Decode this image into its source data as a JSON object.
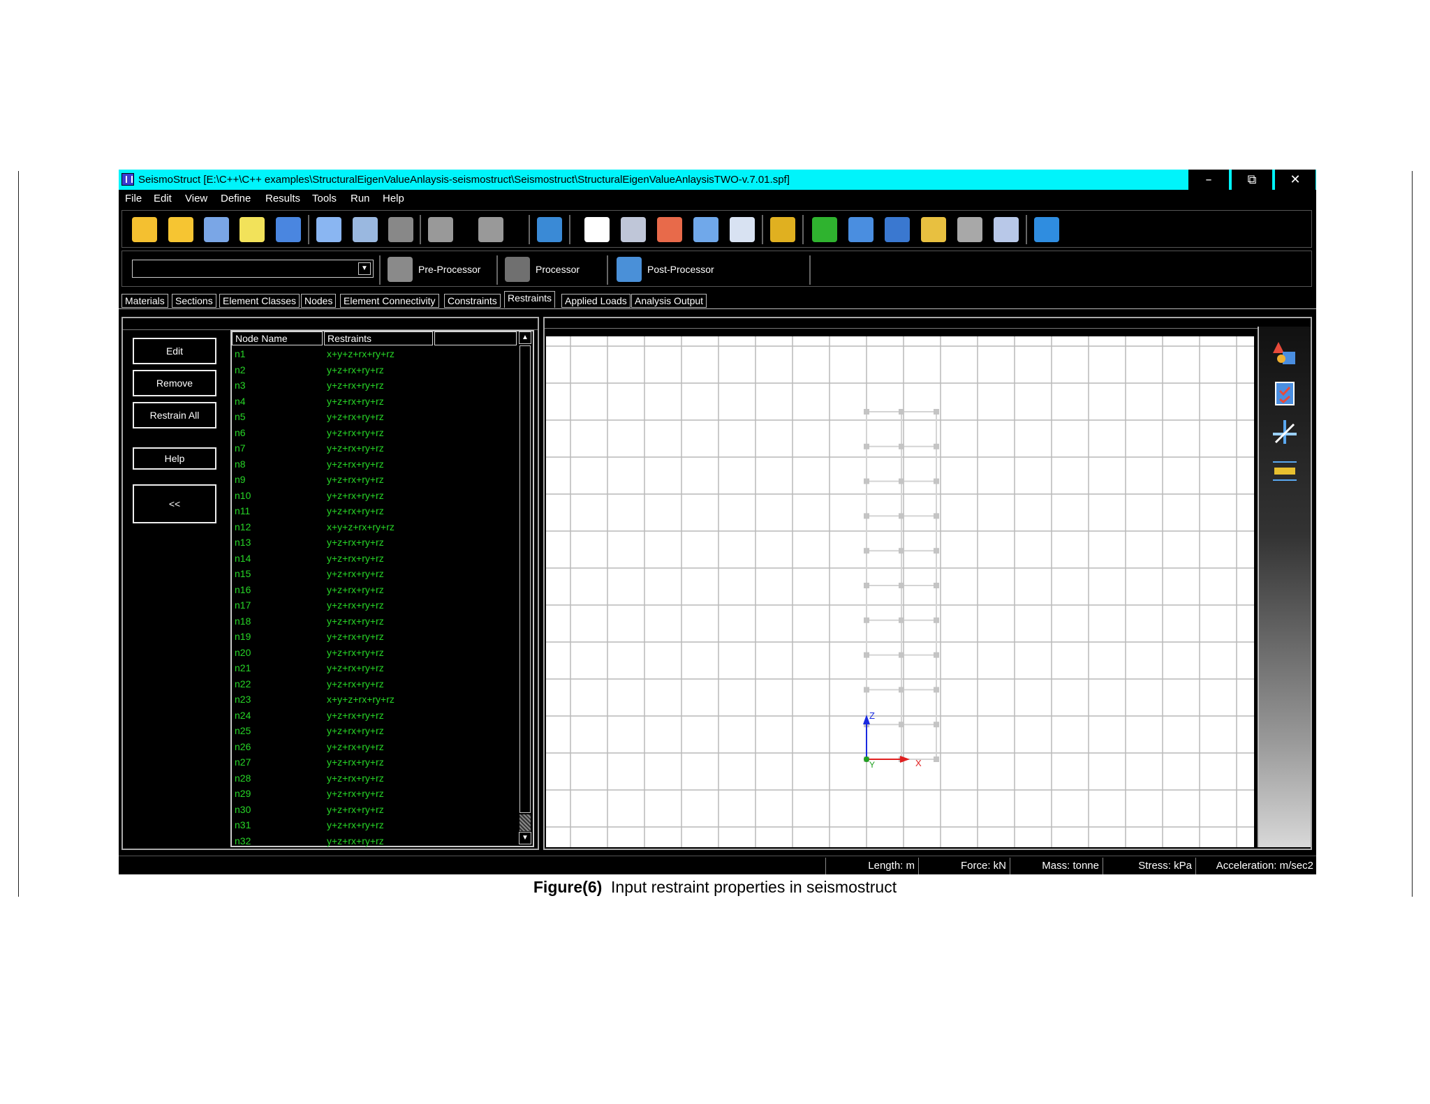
{
  "window": {
    "title": "SeismoStruct   [E:\\C++\\C++ examples\\StructuralEigenValueAnlaysis-seismostruct\\Seismostruct\\StructuralEigenValueAnlaysisTWO-v.7.01.spf]",
    "minimize": "–",
    "restore": "⧉",
    "close": "✕"
  },
  "menu": [
    "File",
    "Edit",
    "View",
    "Define",
    "Results",
    "Tools",
    "Run",
    "Help"
  ],
  "toolbar_icons": [
    {
      "icon": "new-file-icon",
      "color": "#f4c030"
    },
    {
      "icon": "open-folder-icon",
      "color": "#f6c532"
    },
    {
      "icon": "building-icon",
      "color": "#7aa6e6"
    },
    {
      "icon": "wizard-icon",
      "color": "#f2e25a"
    },
    {
      "icon": "save-icon",
      "color": "#4a86e0"
    },
    {
      "icon": "copy-icon",
      "color": "#8ab6f2"
    },
    {
      "icon": "paste-icon",
      "color": "#9ab8e0"
    },
    {
      "icon": "clipboard-icon",
      "color": "#888888"
    },
    {
      "icon": "undo-icon",
      "color": "#999999"
    },
    {
      "icon": "redo-icon",
      "color": "#999999"
    },
    {
      "icon": "network-icon",
      "color": "#3a8ad6"
    },
    {
      "icon": "units-icon",
      "color": "#ffffff"
    },
    {
      "icon": "settings-gear-icon",
      "color": "#bfc6d8"
    },
    {
      "icon": "sparkle-gear-icon",
      "color": "#e86a4a"
    },
    {
      "icon": "calculator-icon",
      "color": "#70a8ea"
    },
    {
      "icon": "table-grid-icon",
      "color": "#d8e2f2"
    },
    {
      "icon": "brush-icon",
      "color": "#e0b020"
    },
    {
      "icon": "help-circle-icon",
      "color": "#2fb32f"
    },
    {
      "icon": "book-icon",
      "color": "#4a8ee0"
    },
    {
      "icon": "manual-check-icon",
      "color": "#3a78d0"
    },
    {
      "icon": "search-document-icon",
      "color": "#e8c040"
    },
    {
      "icon": "film-reel-icon",
      "color": "#a8a8a8"
    },
    {
      "icon": "chat-bubbles-icon",
      "color": "#b8c8e8"
    },
    {
      "icon": "globe-icon",
      "color": "#2f8de0"
    }
  ],
  "modes": {
    "pre": "Pre-Processor",
    "processor": "Processor",
    "post": "Post-Processor"
  },
  "tabs": [
    "Materials",
    "Sections",
    "Element Classes",
    "Nodes",
    "Element Connectivity",
    "Constraints",
    "Restraints",
    "Applied Loads",
    "Analysis Output"
  ],
  "active_tab": "Restraints",
  "buttons": {
    "edit": "Edit",
    "remove": "Remove",
    "restrain_all": "Restrain All",
    "help": "Help",
    "collapse": "<<"
  },
  "table": {
    "columns": [
      "Node Name",
      "Restraints",
      ""
    ],
    "rows": [
      [
        "n1",
        "x+y+z+rx+ry+rz"
      ],
      [
        "n2",
        "y+z+rx+ry+rz"
      ],
      [
        "n3",
        "y+z+rx+ry+rz"
      ],
      [
        "n4",
        "y+z+rx+ry+rz"
      ],
      [
        "n5",
        "y+z+rx+ry+rz"
      ],
      [
        "n6",
        "y+z+rx+ry+rz"
      ],
      [
        "n7",
        "y+z+rx+ry+rz"
      ],
      [
        "n8",
        "y+z+rx+ry+rz"
      ],
      [
        "n9",
        "y+z+rx+ry+rz"
      ],
      [
        "n10",
        "y+z+rx+ry+rz"
      ],
      [
        "n11",
        "y+z+rx+ry+rz"
      ],
      [
        "n12",
        "x+y+z+rx+ry+rz"
      ],
      [
        "n13",
        "y+z+rx+ry+rz"
      ],
      [
        "n14",
        "y+z+rx+ry+rz"
      ],
      [
        "n15",
        "y+z+rx+ry+rz"
      ],
      [
        "n16",
        "y+z+rx+ry+rz"
      ],
      [
        "n17",
        "y+z+rx+ry+rz"
      ],
      [
        "n18",
        "y+z+rx+ry+rz"
      ],
      [
        "n19",
        "y+z+rx+ry+rz"
      ],
      [
        "n20",
        "y+z+rx+ry+rz"
      ],
      [
        "n21",
        "y+z+rx+ry+rz"
      ],
      [
        "n22",
        "y+z+rx+ry+rz"
      ],
      [
        "n23",
        "x+y+z+rx+ry+rz"
      ],
      [
        "n24",
        "y+z+rx+ry+rz"
      ],
      [
        "n25",
        "y+z+rx+ry+rz"
      ],
      [
        "n26",
        "y+z+rx+ry+rz"
      ],
      [
        "n27",
        "y+z+rx+ry+rz"
      ],
      [
        "n28",
        "y+z+rx+ry+rz"
      ],
      [
        "n29",
        "y+z+rx+ry+rz"
      ],
      [
        "n30",
        "y+z+rx+ry+rz"
      ],
      [
        "n31",
        "y+z+rx+ry+rz"
      ],
      [
        "n32",
        "y+z+rx+ry+rz"
      ]
    ]
  },
  "axes": {
    "z": "Z",
    "x": "X",
    "y": "Y"
  },
  "side_tools": [
    {
      "icon": "shapes-render-icon",
      "color": "#e84a3a"
    },
    {
      "icon": "checklist-icon",
      "color": "#4a8ee0"
    },
    {
      "icon": "axes-toggle-icon",
      "color": "#5aa8f0"
    },
    {
      "icon": "section-view-icon",
      "color": "#e8c030"
    }
  ],
  "status": {
    "length": "Length: m",
    "force": "Force: kN",
    "mass": "Mass: tonne",
    "stress": "Stress: kPa",
    "acceleration": "Acceleration: m/sec2"
  },
  "caption": {
    "label": "Figure(6)",
    "text": "Input restraint properties in seismostruct"
  },
  "colors": {
    "titlebar": "#00f4fb",
    "list_text": "#27d627",
    "z_axis": "#1a2ae0",
    "x_axis": "#e02020",
    "y_axis": "#20a020"
  }
}
